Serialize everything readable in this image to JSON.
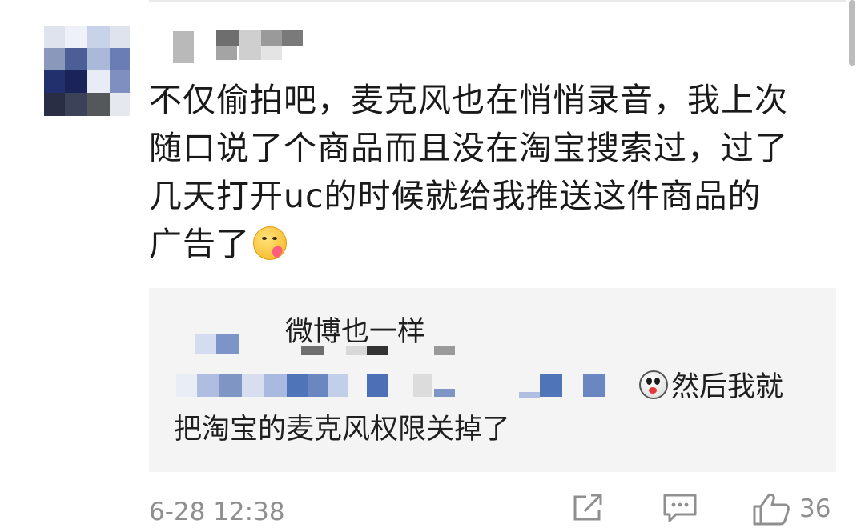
{
  "comment": {
    "text_line1": "不仅偷拍吧，麦克风也在悄悄录音，我上次",
    "text_line2": "随口说了个商品而且没在淘宝搜索过，过了",
    "text_line3": "几天打开uc的时候就给我推送这件商品的",
    "text_line4": "广告了",
    "emoji": "smiling-face-with-heart-icon"
  },
  "reply": {
    "title": "微博也一样",
    "line1": "然后我就",
    "line2": "把淘宝的麦克风权限关掉了",
    "emoji": "shocked-face-icon"
  },
  "footer": {
    "timestamp": "6-28 12:38",
    "likes": "36",
    "icons": [
      "share-icon",
      "comment-icon",
      "like-icon"
    ]
  },
  "colors": {
    "reply_background": "#f4f4f4",
    "meta_text": "#8f8f8f",
    "body_text": "#1a1a1a"
  }
}
